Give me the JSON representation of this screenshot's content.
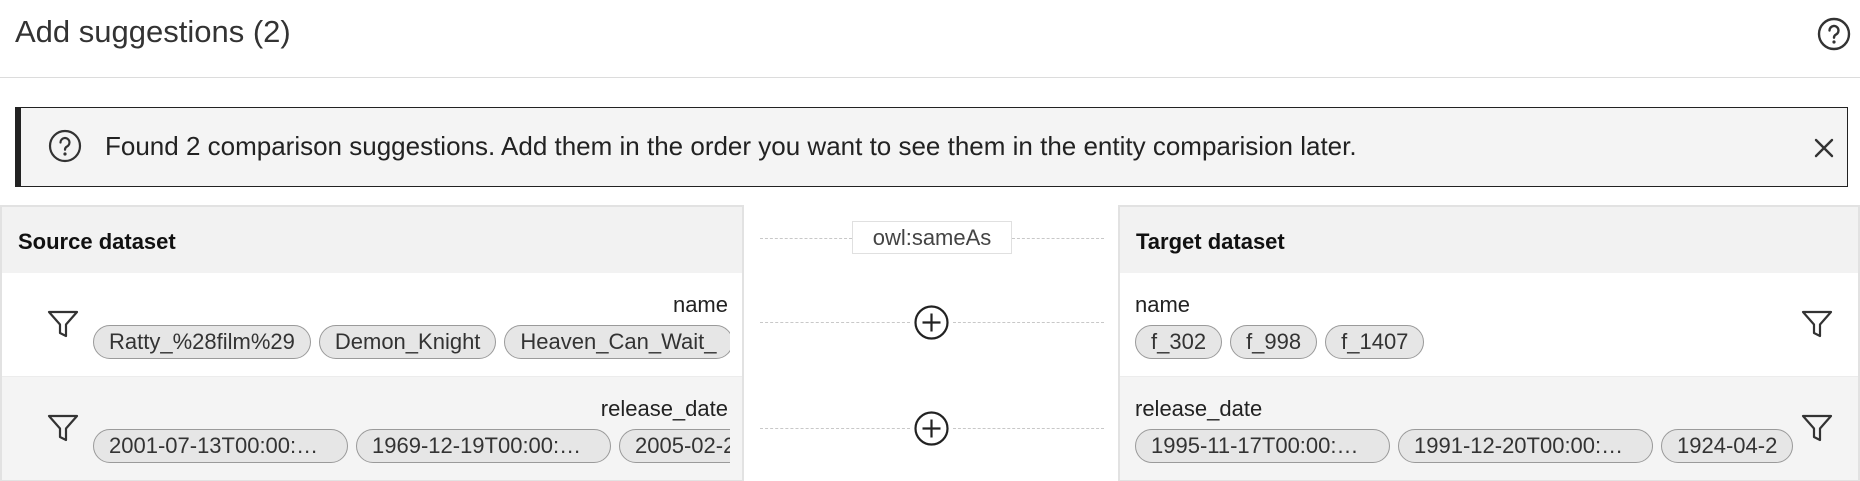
{
  "header": {
    "title": "Add suggestions (2)",
    "help_icon": "help-circle-icon"
  },
  "notification": {
    "icon": "help-circle-icon",
    "message": "Found 2 comparison suggestions. Add them in the order you want to see them in the entity comparision later.",
    "close_icon": "close-icon"
  },
  "link_type": "owl:sameAs",
  "source": {
    "title": "Source dataset",
    "rows": [
      {
        "property": "name",
        "values": [
          "Ratty_%28film%29",
          "Demon_Knight",
          "Heaven_Can_Wait_"
        ]
      },
      {
        "property": "release_date",
        "values": [
          "2001-07-13T00:00:…",
          "1969-12-19T00:00:…",
          "2005-02-2"
        ]
      }
    ]
  },
  "target": {
    "title": "Target dataset",
    "rows": [
      {
        "property": "name",
        "values": [
          "f_302",
          "f_998",
          "f_1407"
        ]
      },
      {
        "property": "release_date",
        "values": [
          "1995-11-17T00:00:…",
          "1991-12-20T00:00:…",
          "1924-04-2"
        ]
      }
    ]
  },
  "colors": {
    "notification_border": "#222222",
    "notification_bg": "#f4f4f4",
    "chip_bg": "#e6e6e6",
    "panel_bg": "#ececec"
  }
}
